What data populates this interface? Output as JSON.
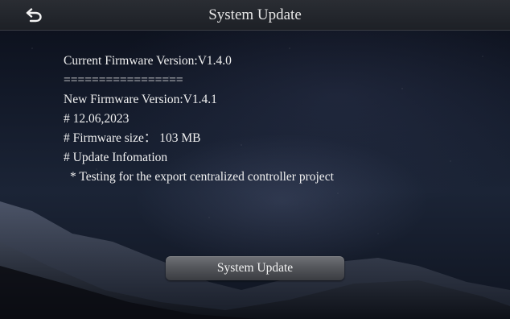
{
  "header": {
    "title": "System Update",
    "back_icon": "back-arrow-icon"
  },
  "firmware": {
    "current_version": "Current Firmware Version:V1.4.0",
    "separator": "=================",
    "new_version": "New Firmware Version:V1.4.1",
    "date": "# 12.06,2023",
    "size": "# Firmware size： 103 MB",
    "update_info_heading": "# Update Infomation",
    "update_note": "* Testing for the export centralized controller project"
  },
  "actions": {
    "update_button_label": "System Update"
  },
  "colors": {
    "header_bg": "#23262c",
    "text": "#f0f0f0",
    "button_bg": "#55575c"
  }
}
